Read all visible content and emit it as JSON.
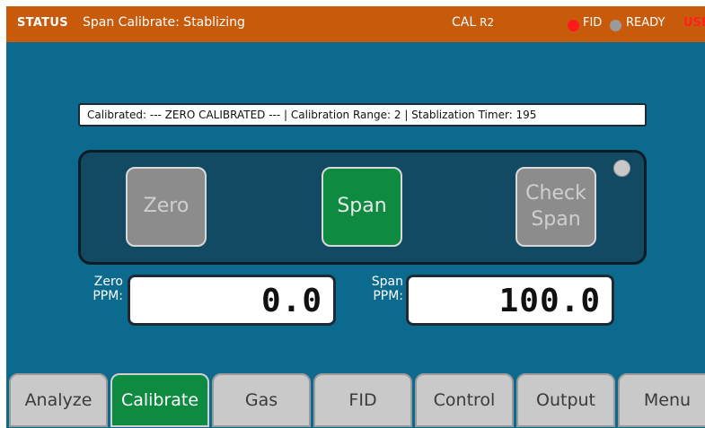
{
  "status_bar": {
    "label": "STATUS",
    "message": "Span Calibrate: Stablizing",
    "cal_label": "CAL",
    "cal_range": "R2",
    "fid_label": "FID",
    "fid_color": "#ff1a1a",
    "ready_label": "READY",
    "ready_color": "#9a9a9a",
    "user_label": "USER",
    "user_color": "#ff2020"
  },
  "info_box": {
    "text": "Calibrated: --- ZERO CALIBRATED --- | Calibration Range: 2 | Stablization Timer: 195"
  },
  "calibration_buttons": {
    "zero": "Zero",
    "span": "Span",
    "check_span": "Check Span",
    "active": "span"
  },
  "readouts": {
    "zero_label": "Zero PPM:",
    "zero_value": "0.0",
    "span_label": "Span PPM:",
    "span_value": "100.0"
  },
  "tabs": [
    {
      "label": "Analyze"
    },
    {
      "label": "Calibrate"
    },
    {
      "label": "Gas"
    },
    {
      "label": "FID"
    },
    {
      "label": "Control"
    },
    {
      "label": "Output"
    },
    {
      "label": "Menu"
    }
  ],
  "active_tab": "Calibrate",
  "colors": {
    "status_bar": "#c85a0c",
    "background": "#0b6a8e",
    "panel": "#114a62",
    "active_green": "#0e8a41",
    "disabled_gray": "#8c8c8c"
  }
}
